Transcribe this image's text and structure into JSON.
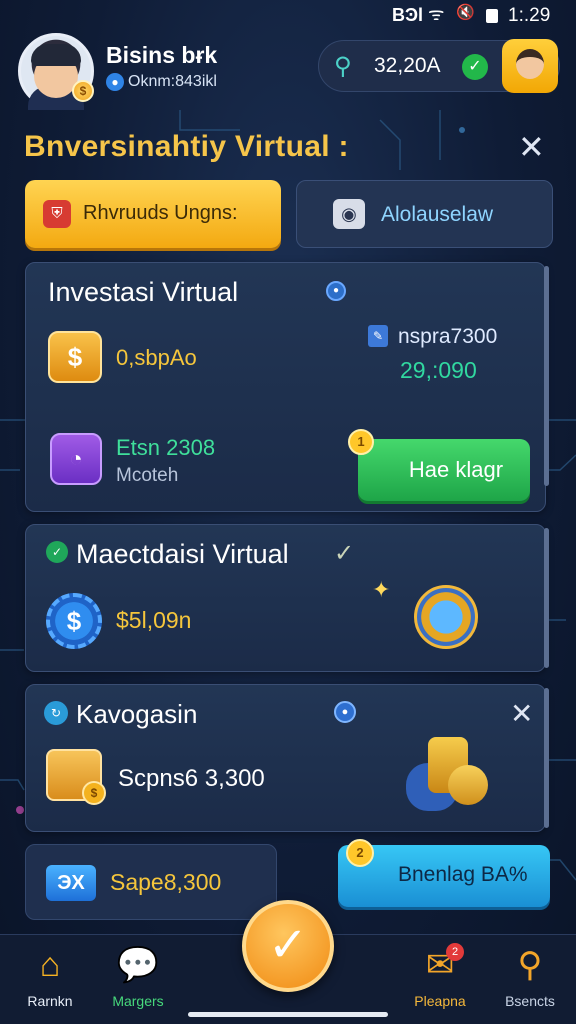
{
  "status_bar": {
    "signal": "ΒϿl",
    "time": "1:.29"
  },
  "profile": {
    "name": "Bisins bɍk",
    "subtitle": "Oknm:843ikl"
  },
  "balance": {
    "value": "32,20A"
  },
  "header": {
    "title": "Bnversinahtiy Virtual :"
  },
  "tabs": [
    {
      "label": "Rhvruuds Ungns:",
      "active": true
    },
    {
      "label": "Alolauselaw",
      "active": false
    }
  ],
  "card1": {
    "title": "Investasi Virtual",
    "coin_value": "0,sbpAo",
    "stat_label": "nspra7300",
    "stat_value": "29,:090",
    "chart_value": "Etsn 2308",
    "chart_label": "Mcoteh",
    "button_label": "Hae klagr"
  },
  "card2": {
    "title": "Maectdaisi Virtual",
    "value": "$5l,09n"
  },
  "card3": {
    "title": "Kavogasin",
    "value": "Scpns6 3,300"
  },
  "mini_card": {
    "icon_text": "ЭX",
    "value": "Sape8,300"
  },
  "action_button": {
    "label": "Bnenlag BA%",
    "badge": "2"
  },
  "bottom_nav": [
    {
      "label": "Rarnkn",
      "icon": "home-icon"
    },
    {
      "label": "Margers",
      "icon": "chat-icon"
    },
    {
      "label": "Pleapna",
      "icon": "mail-icon",
      "badge": "2"
    },
    {
      "label": "Bsencts",
      "icon": "stamp-icon"
    }
  ],
  "colors": {
    "accent_gold": "#f6c54a",
    "success_green": "#31d8a0",
    "action_blue": "#37c7f5",
    "background": "#0f1c36"
  }
}
